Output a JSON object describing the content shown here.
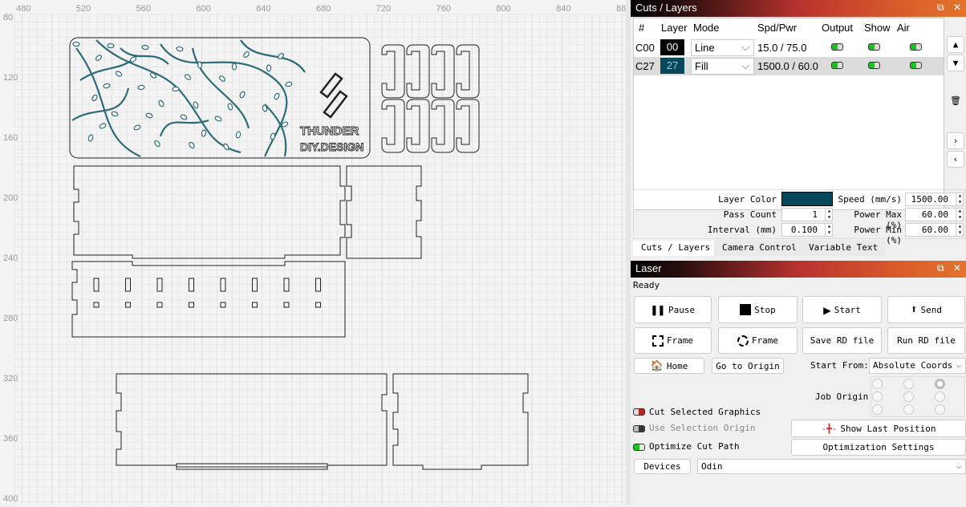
{
  "canvas": {
    "x_ruler": [
      "480",
      "520",
      "560",
      "600",
      "640",
      "680",
      "720",
      "760",
      "800",
      "840",
      "88"
    ],
    "y_ruler": [
      "80",
      "120",
      "160",
      "200",
      "240",
      "280",
      "320",
      "360",
      "400"
    ],
    "logo_text": [
      "THUNDER",
      "DIY.DESIGN"
    ],
    "engrave_color": "#2e6b78"
  },
  "cuts": {
    "title": "Cuts / Layers",
    "columns": [
      "#",
      "Layer",
      "Mode",
      "Spd/Pwr",
      "Output",
      "Show",
      "Air"
    ],
    "rows": [
      {
        "id": "C00",
        "layer": "00",
        "layer_color": "#000000",
        "mode": "Line",
        "spd_pwr": "15.0 / 75.0",
        "output": true,
        "show": true,
        "air": true
      },
      {
        "id": "C27",
        "layer": "27",
        "layer_color": "#06485a",
        "mode": "Fill",
        "spd_pwr": "1500.0 / 60.0",
        "output": true,
        "show": true,
        "air": true
      }
    ],
    "props": {
      "layer_color_label": "Layer Color",
      "layer_color": "#06485a",
      "pass_count_label": "Pass Count",
      "pass_count": "1",
      "interval_label": "Interval (mm)",
      "interval": "0.100",
      "speed_label": "Speed (mm/s)",
      "speed": "1500.00",
      "power_max_label": "Power Max (%)",
      "power_max": "60.00",
      "power_min_label": "Power Min (%)",
      "power_min": "60.00"
    },
    "tabs": [
      "Cuts / Layers",
      "Camera Control",
      "Variable Text"
    ]
  },
  "laser": {
    "title": "Laser",
    "status": "Ready",
    "buttons": {
      "pause": "Pause",
      "stop": "Stop",
      "start": "Start",
      "send": "Send",
      "frame1": "Frame",
      "frame2": "Frame",
      "save_rd": "Save RD file",
      "run_rd": "Run RD file",
      "home": "Home",
      "go_origin": "Go to Origin"
    },
    "start_from_label": "Start From:",
    "start_from": "Absolute Coords",
    "job_origin_label": "Job Origin",
    "job_origin_selected": "top-right",
    "cut_selected": "Cut Selected Graphics",
    "use_selection_origin": "Use Selection Origin",
    "optimize_cut_path": "Optimize Cut Path",
    "show_last_position": "Show Last Position",
    "optimization_settings": "Optimization Settings",
    "devices": "Devices",
    "device": "Odin"
  }
}
